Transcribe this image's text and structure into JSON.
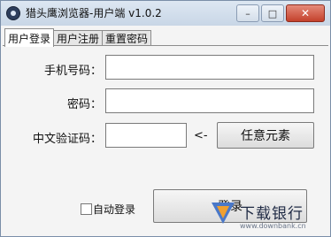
{
  "window": {
    "title": "猎头鹰浏览器-用户端 v1.0.2",
    "minimize_symbol": "–",
    "maximize_symbol": "□",
    "close_symbol": "✕",
    "icon": "app-icon"
  },
  "tabs": [
    {
      "label": "用户登录",
      "active": true
    },
    {
      "label": "用户注册",
      "active": false
    },
    {
      "label": "重置密码",
      "active": false
    }
  ],
  "form": {
    "phone_label": "手机号码：",
    "phone_value": "",
    "password_label": "密码：",
    "password_value": "",
    "captcha_label": "中文验证码：",
    "captcha_value": "",
    "captcha_arrow": "<-",
    "captcha_button": "任意元素",
    "auto_login_label": "自动登录",
    "auto_login_checked": false,
    "login_button": "登录"
  },
  "watermark": {
    "text": "下载银行",
    "url": "www.downbank.cn"
  }
}
